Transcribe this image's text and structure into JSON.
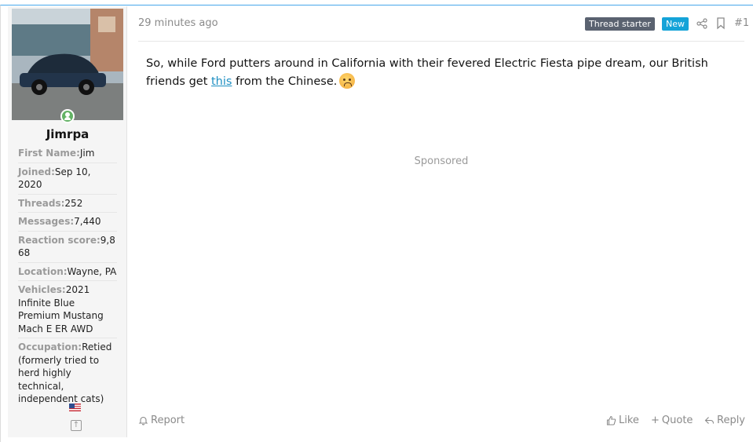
{
  "user": {
    "username": "Jimrpa",
    "avatar_alt": "avatar-photo",
    "status_icon": "online-user-icon",
    "fields": [
      {
        "key": "First Name:",
        "value": "Jim"
      },
      {
        "key": "Joined:",
        "value": "Sep 10, 2020"
      },
      {
        "key": "Threads:",
        "value": "252"
      },
      {
        "key": "Messages:",
        "value": "7,440"
      },
      {
        "key": "Reaction score:",
        "value": "9,868"
      },
      {
        "key": "Location:",
        "value": "Wayne, PA"
      },
      {
        "key": "Vehicles:",
        "value": "2021 Infinite Blue Premium Mustang Mach E ER AWD"
      },
      {
        "key": "Occupation:",
        "value": "Retied (formerly tried to herd highly technical, independent cats)"
      }
    ],
    "flag_icon": "us-flag-icon"
  },
  "post": {
    "timestamp": "29 minutes ago",
    "badge_starter": "Thread starter",
    "badge_new": "New",
    "post_number": "#1",
    "text_before_link": "So, while Ford putters around in California with their fevered Electric Fiesta pipe dream, our British friends get ",
    "link_text": "this",
    "text_after_link": " from the Chinese.",
    "emoji_icon": "frowning-face-icon",
    "sponsored_label": "Sponsored"
  },
  "actions": {
    "report": "Report",
    "like": "Like",
    "quote": "Quote",
    "reply": "Reply"
  },
  "colors": {
    "accent": "#47a7eb",
    "badge_starter_bg": "#5a6270",
    "badge_new_bg": "#14a3d8",
    "link": "#1e8fc2"
  }
}
